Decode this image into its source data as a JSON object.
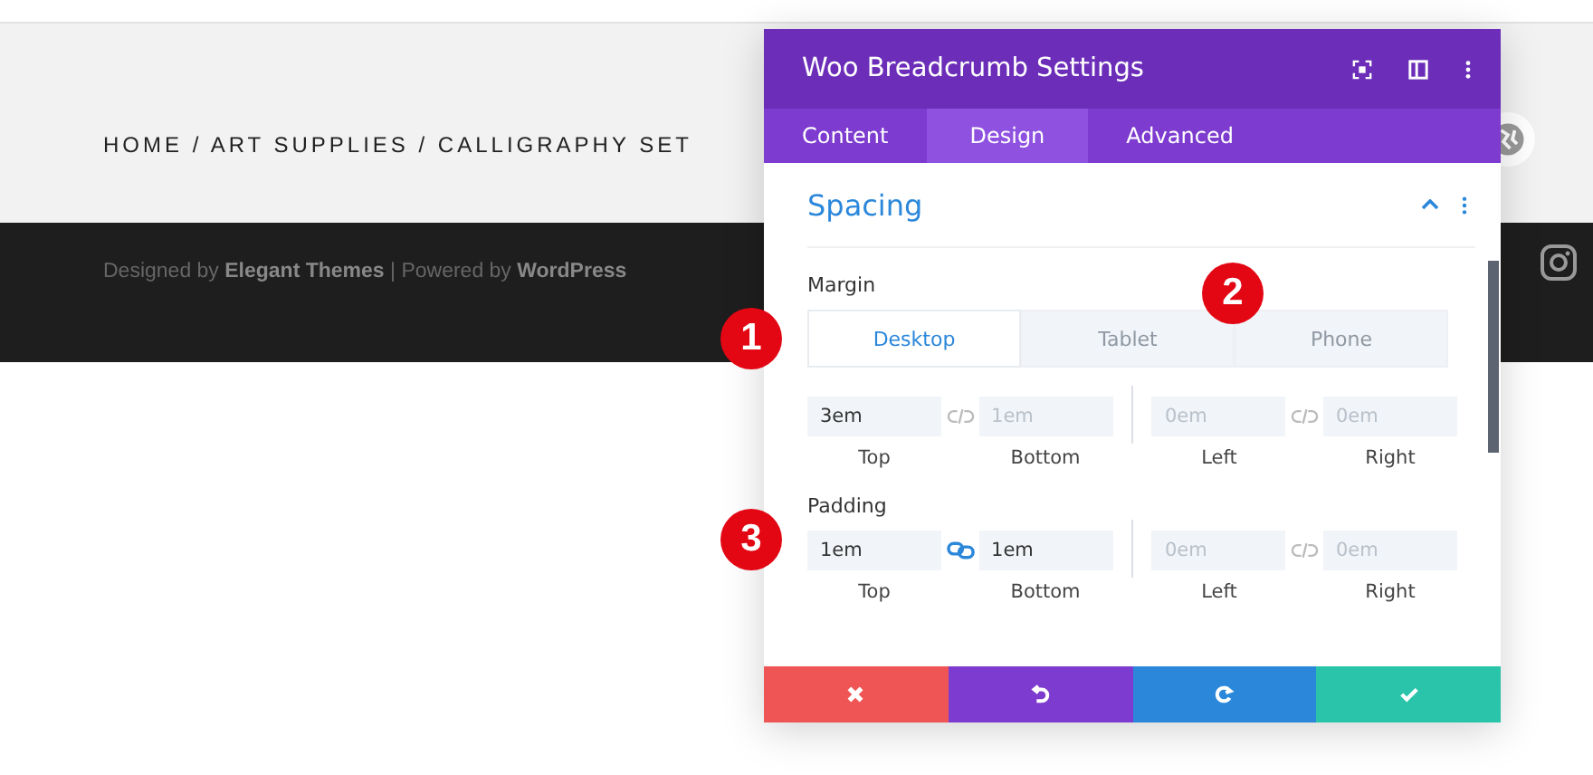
{
  "page": {
    "breadcrumb": "HOME / ART SUPPLIES / CALLIGRAPHY SET",
    "footer_text": "Designed by **Elegant Themes** | Powered by **WordPress**"
  },
  "modal": {
    "title": "Woo Breadcrumb Settings",
    "tabs": [
      {
        "label": "Content",
        "selected": false
      },
      {
        "label": "Design",
        "selected": true
      },
      {
        "label": "Advanced",
        "selected": false
      }
    ],
    "section": {
      "title": "Spacing",
      "expanded": true
    },
    "groups": [
      {
        "label": "Margin",
        "linked_vertical": false,
        "linked_horizontal": false,
        "devices": [
          {
            "label": "Desktop",
            "selected": true,
            "callout": "1"
          },
          {
            "label": "Tablet",
            "selected": false,
            "callout": "2"
          },
          {
            "label": "Phone",
            "selected": false
          }
        ],
        "fields": [
          {
            "label": "Top",
            "value": "3em"
          },
          {
            "label": "Bottom",
            "placeholder": "1em"
          },
          {
            "label": "Left",
            "placeholder": "0em"
          },
          {
            "label": "Right",
            "placeholder": "0em"
          }
        ]
      },
      {
        "label": "Padding",
        "linked_vertical": true,
        "linked_horizontal": false,
        "callout": "3",
        "fields": [
          {
            "label": "Top",
            "value": "1em"
          },
          {
            "label": "Bottom",
            "value": "1em"
          },
          {
            "label": "Left",
            "placeholder": "0em"
          },
          {
            "label": "Right",
            "placeholder": "0em"
          }
        ]
      }
    ],
    "actions": [
      {
        "kind": "cancel"
      },
      {
        "kind": "undo"
      },
      {
        "kind": "redo"
      },
      {
        "kind": "save"
      }
    ]
  }
}
